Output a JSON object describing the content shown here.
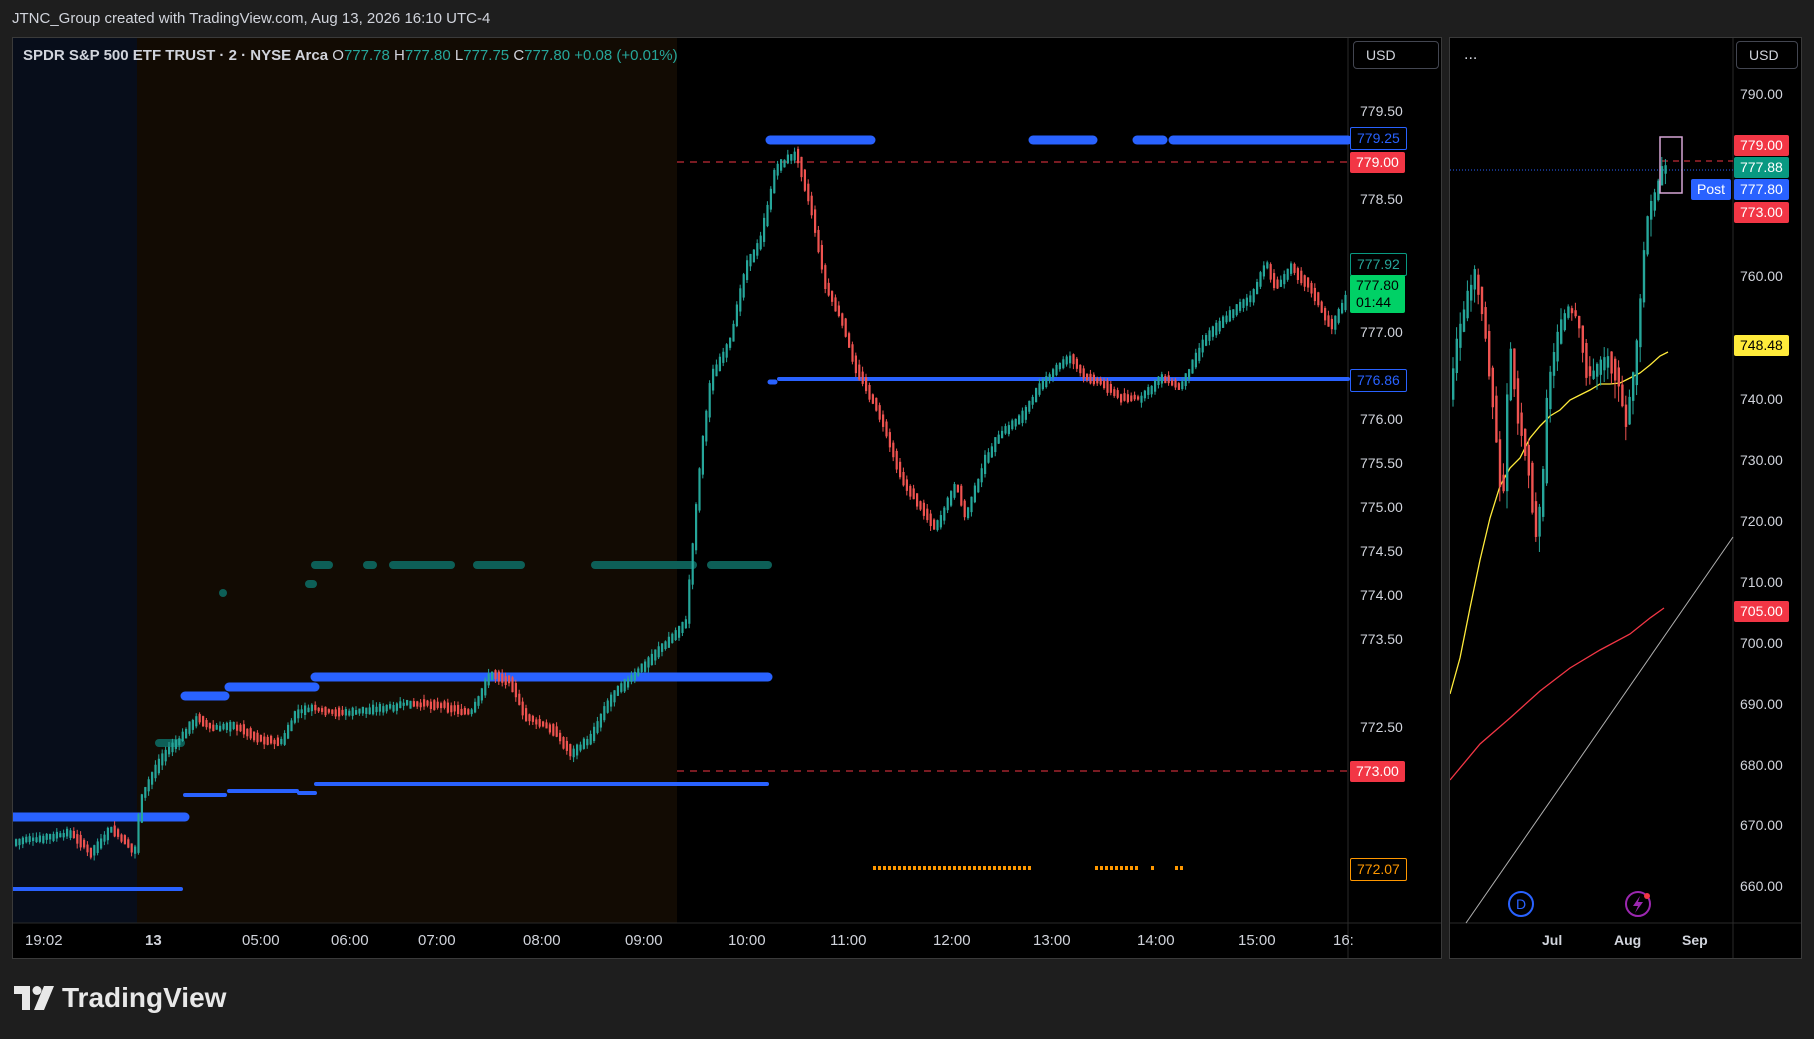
{
  "header": {
    "caption": "JTNC_Group created with TradingView.com, Aug 13, 2026 16:10 UTC-4"
  },
  "left_chart": {
    "symbol": "SPDR S&P 500 ETF TRUST · 2 · NYSE Arca",
    "ohlc": {
      "o_label": "O",
      "o": "777.78",
      "h_label": "H",
      "h": "777.80",
      "l_label": "L",
      "l": "777.75",
      "c_label": "C",
      "c": "777.80",
      "change": "+0.08 (+0.01%)"
    },
    "currency": "USD",
    "price_axis": [
      "779.50",
      "778.50",
      "777.00",
      "776.50",
      "776.00",
      "775.50",
      "775.00",
      "774.50",
      "774.00",
      "773.50",
      "772.50"
    ],
    "time_axis": [
      "19:02",
      "13",
      "05:00",
      "06:00",
      "07:00",
      "08:00",
      "09:00",
      "10:00",
      "11:00",
      "12:00",
      "13:00",
      "14:00",
      "15:00",
      "16:"
    ],
    "tags": {
      "level_blue_top": "779.25",
      "level_red_top": "779.00",
      "last_green": "777.92",
      "current_price": "777.80",
      "countdown": "01:44",
      "level_blue_mid": "776.86",
      "level_red_bottom": "773.00",
      "level_orange": "772.07"
    },
    "colors": {
      "up": "#26a69a",
      "down": "#ef5350",
      "level": "#2962ff",
      "red_level": "#f23645",
      "orange": "#ff9800"
    }
  },
  "right_chart": {
    "menu": "...",
    "currency": "USD",
    "price_axis": [
      "790.00",
      "760.00",
      "740.00",
      "730.00",
      "720.00",
      "710.00",
      "700.00",
      "690.00",
      "680.00",
      "670.00",
      "660.00"
    ],
    "time_axis": [
      "Jul",
      "Aug",
      "Sep"
    ],
    "tags": {
      "red_top": "779.00",
      "green": "777.88",
      "post_label": "Post",
      "blue": "777.80",
      "red_low": "773.00",
      "sma_yellow": "748.48",
      "sma_red": "705.00"
    },
    "event_d": "D",
    "event_icon": "lightning-icon"
  },
  "footer": {
    "brand": "TradingView"
  }
}
